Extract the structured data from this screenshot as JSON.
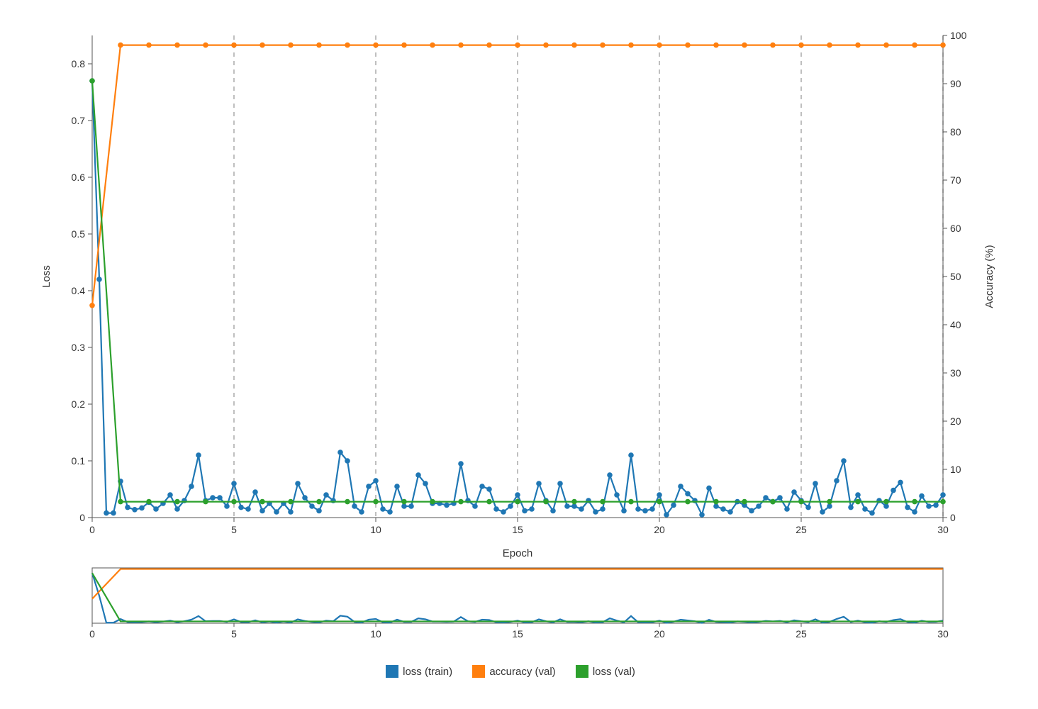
{
  "chart_data": {
    "type": "line",
    "xlabel": "Epoch",
    "y_left_label": "Loss",
    "y_right_label": "Accuracy (%)",
    "y_left_range": [
      0,
      0.85
    ],
    "y_left_ticks": [
      0,
      0.1,
      0.2,
      0.3,
      0.4,
      0.5,
      0.6,
      0.7,
      0.8
    ],
    "y_right_range": [
      0,
      100
    ],
    "y_right_ticks": [
      0,
      10,
      20,
      30,
      40,
      50,
      60,
      70,
      80,
      90,
      100
    ],
    "x_range": [
      0,
      30
    ],
    "x_ticks_main": [
      0,
      5,
      10,
      15,
      20,
      25,
      30
    ],
    "grid_x": [
      5,
      10,
      15,
      20,
      25,
      30
    ],
    "legend": [
      "loss (train)",
      "accuracy (val)",
      "loss (val)"
    ],
    "colors": {
      "loss_train": "#1f77b4",
      "accuracy_val": "#ff7f0e",
      "loss_val": "#2ca02c"
    },
    "series": [
      {
        "name": "loss (train)",
        "axis": "left",
        "color": "#1f77b4",
        "x": [
          0.0,
          0.25,
          0.5,
          0.75,
          1.0,
          1.25,
          1.5,
          1.75,
          2.0,
          2.25,
          2.5,
          2.75,
          3.0,
          3.25,
          3.5,
          3.75,
          4.0,
          4.25,
          4.5,
          4.75,
          5.0,
          5.25,
          5.5,
          5.75,
          6.0,
          6.25,
          6.5,
          6.75,
          7.0,
          7.25,
          7.5,
          7.75,
          8.0,
          8.25,
          8.5,
          8.75,
          9.0,
          9.25,
          9.5,
          9.75,
          10.0,
          10.25,
          10.5,
          10.75,
          11.0,
          11.25,
          11.5,
          11.75,
          12.0,
          12.25,
          12.5,
          12.75,
          13.0,
          13.25,
          13.5,
          13.75,
          14.0,
          14.25,
          14.5,
          14.75,
          15.0,
          15.25,
          15.5,
          15.75,
          16.0,
          16.25,
          16.5,
          16.75,
          17.0,
          17.25,
          17.5,
          17.75,
          18.0,
          18.25,
          18.5,
          18.75,
          19.0,
          19.25,
          19.5,
          19.75,
          20.0,
          20.25,
          20.5,
          20.75,
          21.0,
          21.25,
          21.5,
          21.75,
          22.0,
          22.25,
          22.5,
          22.75,
          23.0,
          23.25,
          23.5,
          23.75,
          24.0,
          24.25,
          24.5,
          24.75,
          25.0,
          25.25,
          25.5,
          25.75,
          26.0,
          26.25,
          26.5,
          26.75,
          27.0,
          27.25,
          27.5,
          27.75,
          28.0,
          28.25,
          28.5,
          28.75,
          29.0,
          29.25,
          29.5,
          29.75,
          30.0
        ],
        "y": [
          0.77,
          0.42,
          0.008,
          0.008,
          0.064,
          0.018,
          0.014,
          0.017,
          0.027,
          0.015,
          0.025,
          0.04,
          0.015,
          0.03,
          0.055,
          0.11,
          0.03,
          0.035,
          0.035,
          0.02,
          0.06,
          0.018,
          0.015,
          0.045,
          0.012,
          0.025,
          0.01,
          0.025,
          0.01,
          0.06,
          0.035,
          0.02,
          0.012,
          0.04,
          0.03,
          0.115,
          0.1,
          0.02,
          0.01,
          0.055,
          0.065,
          0.015,
          0.01,
          0.055,
          0.02,
          0.02,
          0.075,
          0.06,
          0.025,
          0.025,
          0.022,
          0.025,
          0.095,
          0.03,
          0.02,
          0.055,
          0.05,
          0.015,
          0.01,
          0.02,
          0.04,
          0.012,
          0.015,
          0.06,
          0.03,
          0.012,
          0.06,
          0.02,
          0.02,
          0.015,
          0.03,
          0.01,
          0.015,
          0.075,
          0.04,
          0.012,
          0.11,
          0.015,
          0.012,
          0.015,
          0.04,
          0.005,
          0.022,
          0.055,
          0.042,
          0.03,
          0.005,
          0.052,
          0.02,
          0.015,
          0.01,
          0.028,
          0.022,
          0.012,
          0.02,
          0.035,
          0.028,
          0.035,
          0.015,
          0.045,
          0.03,
          0.018,
          0.06,
          0.01,
          0.02,
          0.065,
          0.1,
          0.018,
          0.04,
          0.015,
          0.008,
          0.03,
          0.02,
          0.048,
          0.062,
          0.018,
          0.01,
          0.038,
          0.02,
          0.022,
          0.04
        ]
      },
      {
        "name": "accuracy (val)",
        "axis": "right",
        "color": "#ff7f0e",
        "x": [
          0,
          1,
          2,
          3,
          4,
          5,
          6,
          7,
          8,
          9,
          10,
          11,
          12,
          13,
          14,
          15,
          16,
          17,
          18,
          19,
          20,
          21,
          22,
          23,
          24,
          25,
          26,
          27,
          28,
          29,
          30
        ],
        "y": [
          44,
          98,
          98,
          98,
          98,
          98,
          98,
          98,
          98,
          98,
          98,
          98,
          98,
          98,
          98,
          98,
          98,
          98,
          98,
          98,
          98,
          98,
          98,
          98,
          98,
          98,
          98,
          98,
          98,
          98,
          98
        ]
      },
      {
        "name": "loss (val)",
        "axis": "left",
        "color": "#2ca02c",
        "x": [
          0,
          1,
          2,
          3,
          4,
          5,
          6,
          7,
          8,
          9,
          10,
          11,
          12,
          13,
          14,
          15,
          16,
          17,
          18,
          19,
          20,
          21,
          22,
          23,
          24,
          25,
          26,
          27,
          28,
          29,
          30
        ],
        "y": [
          0.77,
          0.028,
          0.028,
          0.028,
          0.028,
          0.028,
          0.028,
          0.028,
          0.028,
          0.028,
          0.028,
          0.028,
          0.028,
          0.028,
          0.028,
          0.028,
          0.028,
          0.028,
          0.028,
          0.028,
          0.028,
          0.028,
          0.028,
          0.028,
          0.028,
          0.028,
          0.028,
          0.028,
          0.028,
          0.028,
          0.028
        ]
      }
    ],
    "overview_panel": true
  }
}
